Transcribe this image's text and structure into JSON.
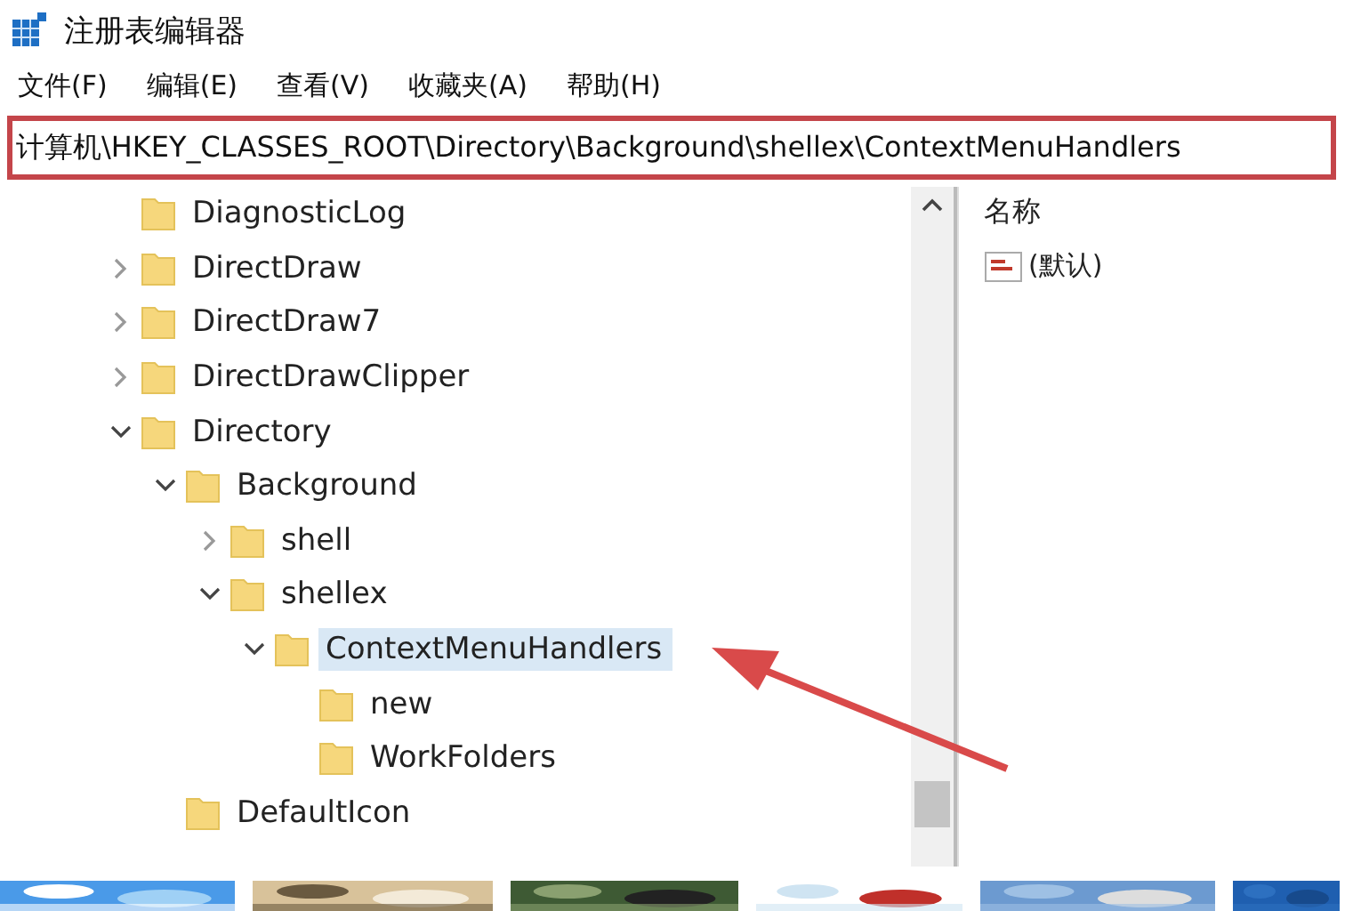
{
  "window": {
    "title": "注册表编辑器"
  },
  "menu": [
    "文件(F)",
    "编辑(E)",
    "查看(V)",
    "收藏夹(A)",
    "帮助(H)"
  ],
  "address_bar": {
    "value": "计算机\\HKEY_CLASSES_ROOT\\Directory\\Background\\shellex\\ContextMenuHandlers",
    "highlighted": true
  },
  "tree": [
    {
      "label": "DiagnosticLog",
      "selected": false
    },
    {
      "label": "DirectDraw",
      "expanded": false,
      "selected": false
    },
    {
      "label": "DirectDraw7",
      "expanded": false,
      "selected": false
    },
    {
      "label": "DirectDrawClipper",
      "expanded": false,
      "selected": false
    },
    {
      "label": "Directory",
      "expanded": true,
      "selected": false,
      "children": [
        {
          "label": "Background",
          "expanded": true,
          "selected": false,
          "children": [
            {
              "label": "shell",
              "expanded": false,
              "selected": false
            },
            {
              "label": "shellex",
              "expanded": true,
              "selected": false,
              "children": [
                {
                  "label": "ContextMenuHandlers",
                  "expanded": true,
                  "selected": true,
                  "children": [
                    {
                      "label": "new",
                      "selected": false
                    },
                    {
                      "label": "WorkFolders",
                      "selected": false
                    }
                  ]
                }
              ]
            }
          ]
        },
        {
          "label": "DefaultIcon",
          "selected": false
        }
      ]
    }
  ],
  "values_pane": {
    "columns": [
      "名称"
    ],
    "rows": [
      {
        "name": "(默认)"
      }
    ]
  },
  "annotations": [
    {
      "kind": "arrow"
    }
  ],
  "thumbnails": [
    {
      "kind": "picture"
    },
    {
      "kind": "picture"
    },
    {
      "kind": "picture"
    },
    {
      "kind": "picture"
    },
    {
      "kind": "picture"
    },
    {
      "kind": "picture"
    }
  ]
}
